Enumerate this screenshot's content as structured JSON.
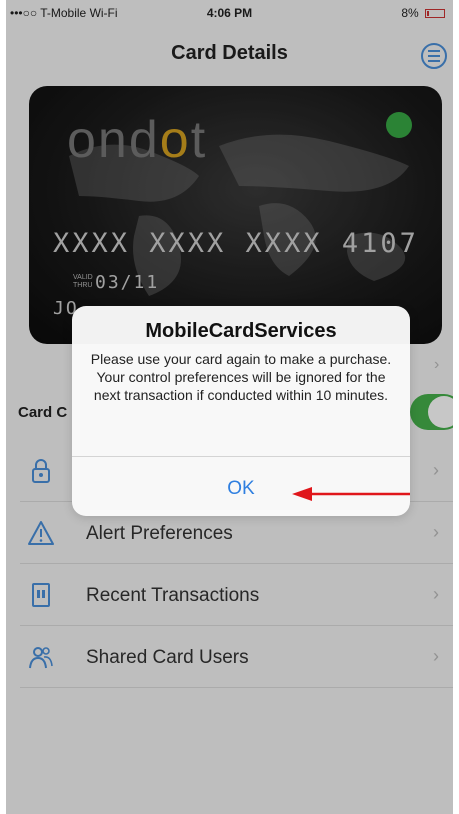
{
  "status_bar": {
    "carrier": "•••○○ T-Mobile Wi-Fi",
    "time": "4:06 PM",
    "battery": "8%"
  },
  "nav": {
    "title": "Card Details"
  },
  "card": {
    "brand_prefix": "ond",
    "brand_accent": "o",
    "brand_suffix": "t",
    "number": "XXXX XXXX XXXX 4107",
    "valid_label": "VALID THRU",
    "valid_date": "03/11",
    "holder_partial": "JO",
    "power_state": "on"
  },
  "controls": {
    "label": "Card C",
    "toggle_on": true
  },
  "menu_items": [
    {
      "label": "",
      "icon": "lock-icon"
    },
    {
      "label": "Alert Preferences",
      "icon": "warning-icon"
    },
    {
      "label": "Recent Transactions",
      "icon": "receipt-icon"
    },
    {
      "label": "Shared Card Users",
      "icon": "users-icon"
    }
  ],
  "alert": {
    "title": "MobileCardServices",
    "message": "Please use your card again to make a purchase. Your control preferences will be ignored for the next transaction if conducted within 10 minutes.",
    "ok_label": "OK"
  },
  "colors": {
    "accent_blue": "#2f7fe0",
    "toggle_green": "#46b04b",
    "arrow_red": "#e0161b",
    "logo_gold": "#d4a020"
  }
}
